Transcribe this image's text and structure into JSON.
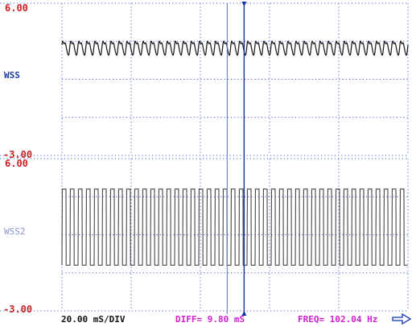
{
  "colors": {
    "scale_label": "#cc2222",
    "grid": "#4466cc",
    "trace_wss": "#222222",
    "trace_wss2": "#333333",
    "label_wss": "#1a3aa0",
    "label_wss2": "#8a96cc",
    "cursor": "#1133aa",
    "cursor_light": "#5577cc",
    "timebase": "#111111",
    "diff": "#cc22cc",
    "freq": "#cc22cc",
    "arrow": "#1133aa"
  },
  "status": {
    "timebase": "20.00 mS/DIV",
    "diff": "DIFF= 9.80 mS",
    "freq": "FREQ= 102.04 Hz",
    "arrow_icon": "right-arrow-icon"
  },
  "chart_data": [
    {
      "type": "line",
      "channel_label": "WSS",
      "ylim": [
        -3.0,
        6.0
      ],
      "ytick_labels": [
        "6.00",
        "-3.00"
      ],
      "x_unit": "ms",
      "xlim": [
        0,
        200
      ],
      "time_per_div": "20.00 mS/DIV",
      "waveform": "ripple",
      "baseline": 3.4,
      "amplitude": 0.45,
      "cycles": 43,
      "grid": true
    },
    {
      "type": "line",
      "channel_label": "WSS2",
      "ylim": [
        -3.0,
        6.0
      ],
      "ytick_labels": [
        "6.00",
        "-3.00"
      ],
      "x_unit": "ms",
      "xlim": [
        0,
        200
      ],
      "time_per_div": "20.00 mS/DIV",
      "waveform": "square",
      "high": 4.2,
      "low": -0.3,
      "cycles": 43,
      "grid": true
    }
  ],
  "cursors": {
    "a_ms": 95.5,
    "b_ms": 105.3,
    "diff_ms": 9.8,
    "freq_hz": 102.04
  }
}
